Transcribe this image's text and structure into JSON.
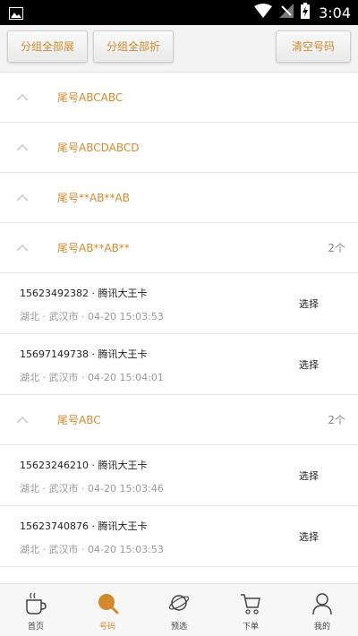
{
  "statusbar": {
    "time": "3:04"
  },
  "toolbar": {
    "expand_label": "分组全部展",
    "collapse_label": "分组全部折",
    "clear_label": "清空号码"
  },
  "groups": [
    {
      "name": "尾号ABCABC",
      "count": ""
    },
    {
      "name": "尾号ABCDABCD",
      "count": ""
    },
    {
      "name": "尾号**AB**AB",
      "count": ""
    },
    {
      "name": "尾号AB**AB**",
      "count": "2个"
    },
    {
      "name": "尾号ABC",
      "count": "2个"
    }
  ],
  "items": [
    {
      "number": "15623492382 · 腾讯大王卡",
      "location": "湖北 · 武汉市 · 04-20 15:03:53",
      "action": "选择"
    },
    {
      "number": "15697149738 · 腾讯大王卡",
      "location": "湖北 · 武汉市 · 04-20 15:04:01",
      "action": "选择"
    },
    {
      "number": "15623246210 · 腾讯大王卡",
      "location": "湖北 · 武汉市 · 04-20 15:03:46",
      "action": "选择"
    },
    {
      "number": "15623740876 · 腾讯大王卡",
      "location": "湖北 · 武汉市 · 04-20 15:03:53",
      "action": "选择"
    }
  ],
  "tabs": [
    {
      "label": "首页",
      "icon": "coffee-cup-icon"
    },
    {
      "label": "号码",
      "icon": "search-icon",
      "active": true
    },
    {
      "label": "预选",
      "icon": "planet-icon"
    },
    {
      "label": "下单",
      "icon": "cart-icon"
    },
    {
      "label": "我的",
      "icon": "user-icon"
    }
  ],
  "colors": {
    "accent": "#d28a2d",
    "divider": "#e6e6e6"
  }
}
